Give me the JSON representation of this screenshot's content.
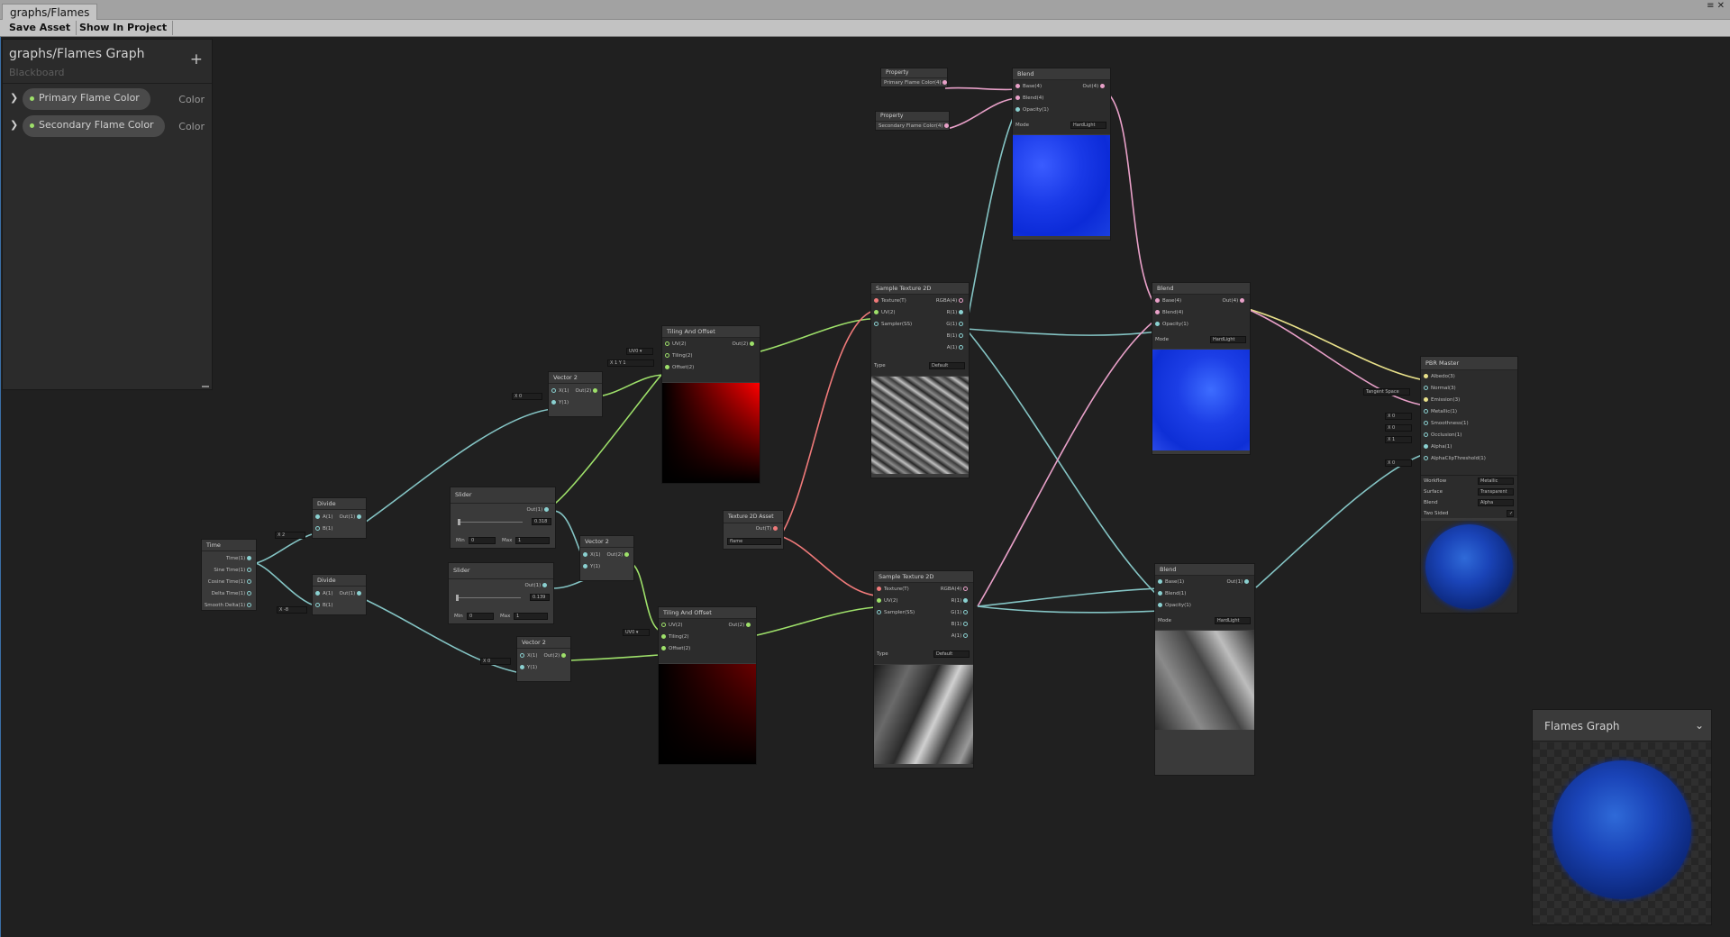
{
  "window": {
    "tab_title": "graphs/Flames",
    "controls": "≡ ✕"
  },
  "toolbar": {
    "save_label": "Save Asset",
    "show_label": "Show In Project"
  },
  "blackboard": {
    "title": "graphs/Flames Graph",
    "subtitle": "Blackboard",
    "add_symbol": "+",
    "properties": [
      {
        "name": "Primary Flame Color",
        "type": "Color"
      },
      {
        "name": "Secondary Flame Color",
        "type": "Color"
      }
    ]
  },
  "nodes": {
    "prop1": {
      "title": "Property",
      "out": "Primary Flame Color(4)"
    },
    "prop2": {
      "title": "Property",
      "out": "Secondary Flame Color(4)"
    },
    "blend_top": {
      "title": "Blend",
      "in": [
        "Base(4)",
        "Blend(4)",
        "Opacity(1)"
      ],
      "out": "Out(4)",
      "mode_label": "Mode",
      "mode": "HardLight"
    },
    "sample1": {
      "title": "Sample Texture 2D",
      "in": [
        "Texture(T)",
        "UV(2)",
        "Sampler(SS)"
      ],
      "out": [
        "RGBA(4)",
        "R(1)",
        "G(1)",
        "B(1)",
        "A(1)"
      ],
      "type_label": "Type",
      "type": "Default"
    },
    "sample2": {
      "title": "Sample Texture 2D",
      "in": [
        "Texture(T)",
        "UV(2)",
        "Sampler(SS)"
      ],
      "out": [
        "RGBA(4)",
        "R(1)",
        "G(1)",
        "B(1)",
        "A(1)"
      ],
      "type_label": "Type",
      "type": "Default"
    },
    "blend_mid": {
      "title": "Blend",
      "in": [
        "Base(4)",
        "Blend(4)",
        "Opacity(1)"
      ],
      "out": "Out(4)",
      "mode_label": "Mode",
      "mode": "HardLight"
    },
    "blend_low": {
      "title": "Blend",
      "in": [
        "Base(1)",
        "Blend(1)",
        "Opacity(1)"
      ],
      "out": "Out(1)",
      "mode_label": "Mode",
      "mode": "HardLight"
    },
    "tiling1": {
      "title": "Tiling And Offset",
      "in": [
        "UV(2)",
        "Tiling(2)",
        "Offset(2)"
      ],
      "out": "Out(2)",
      "uv": "UV0 ▾",
      "tiling": "X 1  Y 1"
    },
    "tiling2": {
      "title": "Tiling And Offset",
      "in": [
        "UV(2)",
        "Tiling(2)",
        "Offset(2)"
      ],
      "out": "Out(2)",
      "uv": "UV0 ▾"
    },
    "vec2a": {
      "title": "Vector 2",
      "in": [
        "X(1)",
        "Y(1)"
      ],
      "out": "Out(2)",
      "x": "X 0"
    },
    "vec2b": {
      "title": "Vector 2",
      "in": [
        "X(1)",
        "Y(1)"
      ],
      "out": "Out(2)"
    },
    "vec2c": {
      "title": "Vector 2",
      "in": [
        "X(1)",
        "Y(1)"
      ],
      "out": "Out(2)",
      "x": "X 0"
    },
    "slider1": {
      "title": "Slider",
      "out": "Out(1)",
      "value": "0.318",
      "min_label": "Min",
      "min": "0",
      "max_label": "Max",
      "max": "1"
    },
    "slider2": {
      "title": "Slider",
      "out": "Out(1)",
      "value": "0.139",
      "min_label": "Min",
      "min": "0",
      "max_label": "Max",
      "max": "1"
    },
    "tex_asset": {
      "title": "Texture 2D Asset",
      "out": "Out(T)",
      "asset": "flame"
    },
    "divide1": {
      "title": "Divide",
      "in": [
        "A(1)",
        "B(1)"
      ],
      "out": "Out(1)",
      "b": "X 2"
    },
    "divide2": {
      "title": "Divide",
      "in": [
        "A(1)",
        "B(1)"
      ],
      "out": "Out(1)",
      "b": "X -8"
    },
    "time": {
      "title": "Time",
      "out": [
        "Time(1)",
        "Sine Time(1)",
        "Cosine Time(1)",
        "Delta Time(1)",
        "Smooth Delta(1)"
      ]
    },
    "pbr": {
      "title": "PBR Master",
      "in": [
        "Albedo(3)",
        "Normal(3)",
        "Emission(3)",
        "Metallic(1)",
        "Smoothness(1)",
        "Occlusion(1)",
        "Alpha(1)",
        "AlphaClipThreshold(1)"
      ],
      "normal_space": "Tangent Space",
      "inputs_values": [
        "X 0",
        "X 0",
        "X 1",
        "X 0"
      ],
      "settings": [
        {
          "label": "Workflow",
          "value": "Metallic"
        },
        {
          "label": "Surface",
          "value": "Transparent"
        },
        {
          "label": "Blend",
          "value": "Alpha"
        },
        {
          "label": "Two Sided",
          "value": "✓"
        }
      ]
    }
  },
  "main_preview": {
    "title": "Flames Graph",
    "chevron": "⌄"
  },
  "colors": {
    "accent_blue": "#1a44d8",
    "wire_green": "#9ee06a",
    "wire_cyan": "#84c4c4",
    "wire_pink": "#e8a0c8",
    "wire_red": "#f07a7a",
    "wire_yellow": "#e8e08a"
  }
}
